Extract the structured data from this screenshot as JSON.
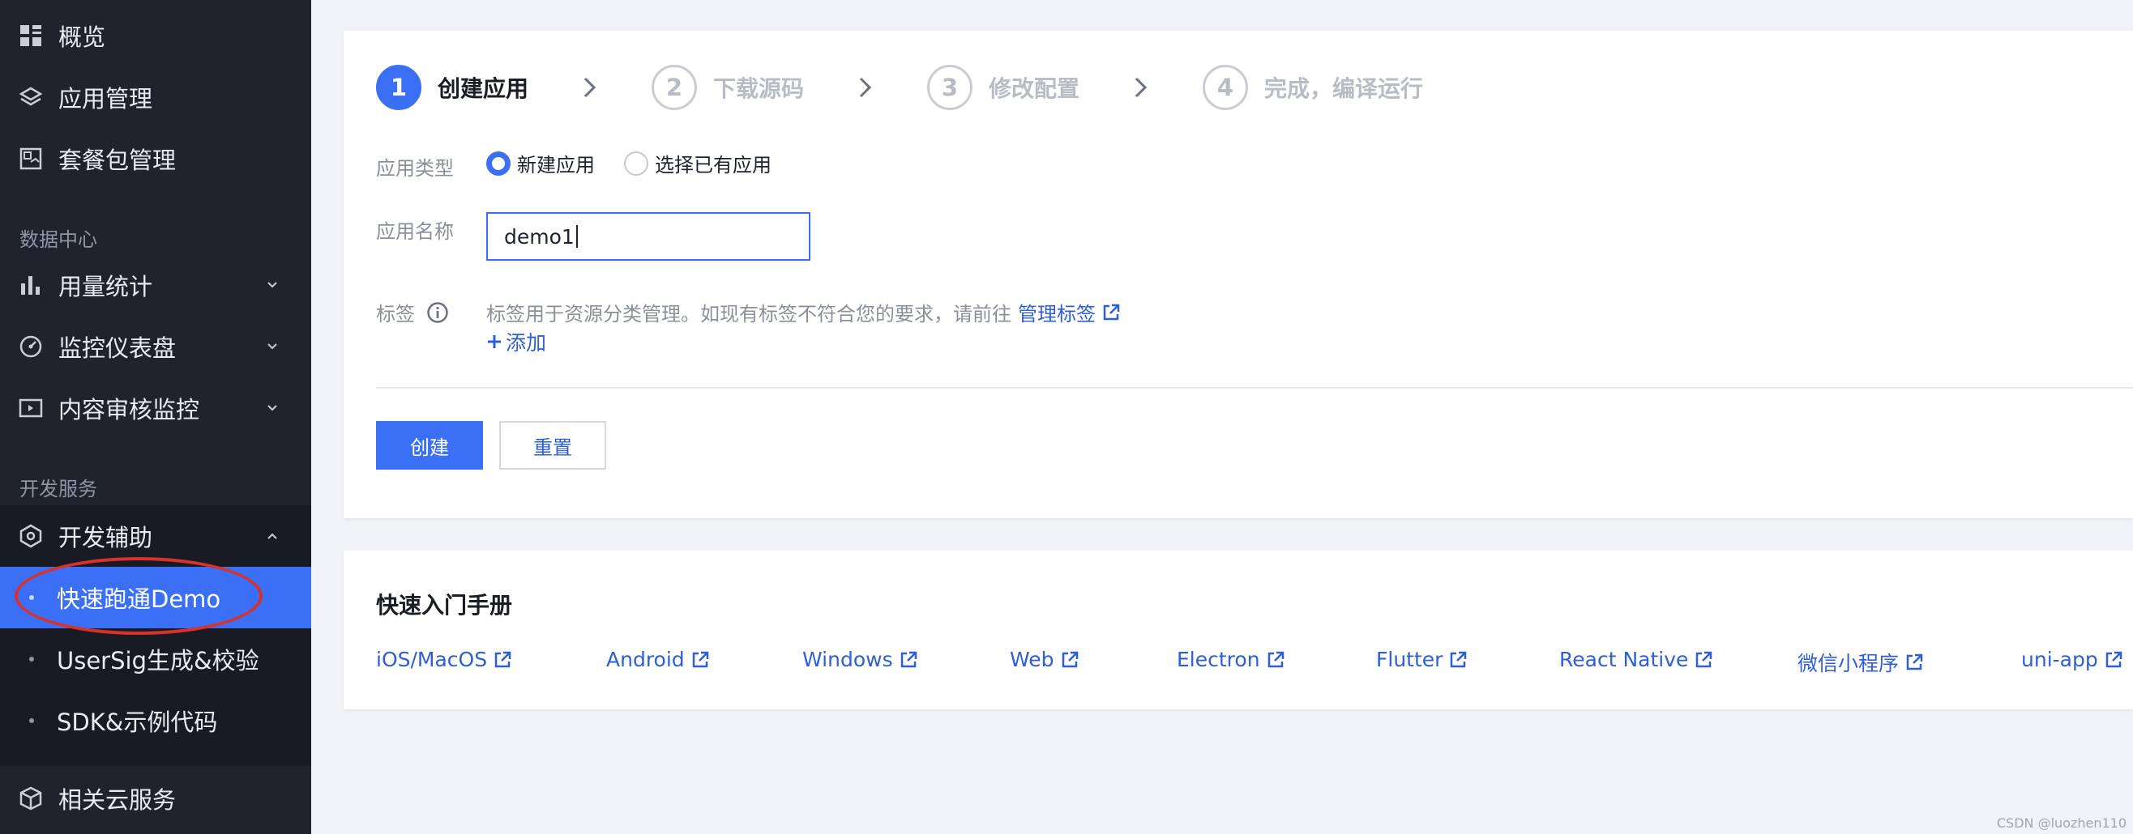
{
  "sidebar": {
    "items_top": [
      {
        "label": "概览",
        "icon": "grid-icon"
      },
      {
        "label": "应用管理",
        "icon": "layers-icon"
      },
      {
        "label": "套餐包管理",
        "icon": "package-icon"
      }
    ],
    "section_data": "数据中心",
    "items_data": [
      {
        "label": "用量统计",
        "icon": "bar-chart-icon"
      },
      {
        "label": "监控仪表盘",
        "icon": "gauge-icon"
      },
      {
        "label": "内容审核监控",
        "icon": "monitor-icon"
      }
    ],
    "section_dev": "开发服务",
    "dev_group": {
      "label": "开发辅助",
      "icon": "hexagon-icon"
    },
    "dev_sub": [
      {
        "label": "快速跑通Demo"
      },
      {
        "label": "UserSig生成&校验"
      },
      {
        "label": "SDK&示例代码"
      }
    ],
    "bottom_item": {
      "label": "相关云服务",
      "icon": "cube-icon"
    }
  },
  "steps": [
    {
      "num": "1",
      "label": "创建应用"
    },
    {
      "num": "2",
      "label": "下载源码"
    },
    {
      "num": "3",
      "label": "修改配置"
    },
    {
      "num": "4",
      "label": "完成，编译运行"
    }
  ],
  "form": {
    "type_label": "应用类型",
    "radio_new": "新建应用",
    "radio_existing": "选择已有应用",
    "name_label": "应用名称",
    "name_value": "demo1",
    "tag_label": "标签",
    "tag_hint": "标签用于资源分类管理。如现有标签不符合您的要求，请前往",
    "tag_link": "管理标签",
    "add_label": "添加",
    "create_button": "创建",
    "reset_button": "重置"
  },
  "quickstart": {
    "title": "快速入门手册",
    "links": [
      "iOS/MacOS",
      "Android",
      "Windows",
      "Web",
      "Electron",
      "Flutter",
      "React Native",
      "微信小程序",
      "uni-app"
    ]
  },
  "watermark": "CSDN @luozhen110",
  "colors": {
    "accent": "#3b6ff5",
    "sidebar_bg": "#1f232e",
    "annotation": "#d8322b"
  }
}
